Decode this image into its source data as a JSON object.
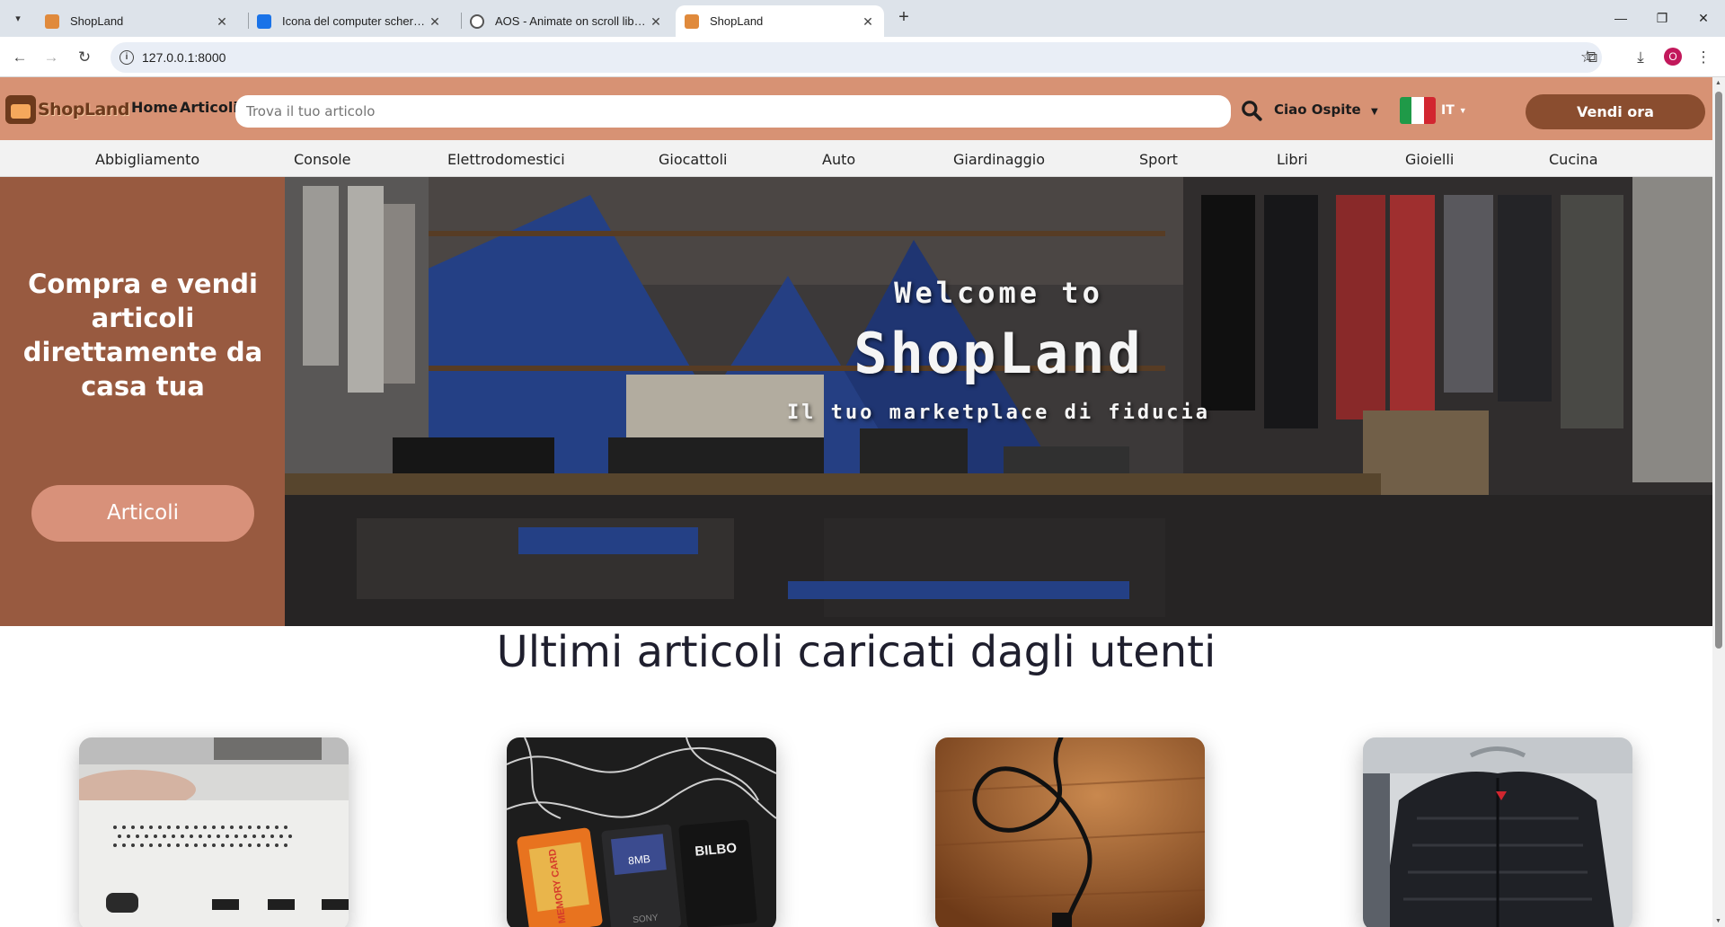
{
  "browser": {
    "tabs": [
      {
        "title": "ShopLand",
        "favicon": "shopland-favicon",
        "active": false
      },
      {
        "title": "Icona del computer schermo vuoto",
        "favicon": "docs-favicon",
        "active": false
      },
      {
        "title": "AOS - Animate on scroll library",
        "favicon": "globe-favicon",
        "active": false
      },
      {
        "title": "ShopLand",
        "favicon": "shopland-favicon",
        "active": true
      }
    ],
    "url": "127.0.0.1:8000",
    "profile_initial": "O"
  },
  "header": {
    "logo_text": "ShopLand",
    "nav": {
      "home": "Home",
      "articles": "Articoli"
    },
    "search_placeholder": "Trova il tuo articolo",
    "user_greeting": "Ciao Ospite",
    "language": "IT",
    "sell_button": "Vendi ora"
  },
  "categories": [
    "Abbigliamento",
    "Console",
    "Elettrodomestici",
    "Giocattoli",
    "Auto",
    "Giardinaggio",
    "Sport",
    "Libri",
    "Gioielli",
    "Cucina"
  ],
  "hero": {
    "claim": "Compra e vendi articoli direttamente da casa tua",
    "button": "Articoli",
    "welcome": "Welcome to",
    "brand": "ShopLand",
    "tagline": "Il tuo marketplace di fiducia"
  },
  "latest": {
    "title": "Ultimi articoli caricati dagli utenti",
    "cards": [
      {
        "image": "console-ports-photo"
      },
      {
        "image": "memory-cards-photo",
        "printed_text": [
          "MEMORY CARD",
          "8MB",
          "BILBO",
          "SONY"
        ]
      },
      {
        "image": "power-cable-photo"
      },
      {
        "image": "black-jacket-photo"
      }
    ]
  },
  "colors": {
    "header": "#d79274",
    "hero_side": "#985a40",
    "hero_button": "#d8917a",
    "sell_button": "#8a4d2f"
  }
}
